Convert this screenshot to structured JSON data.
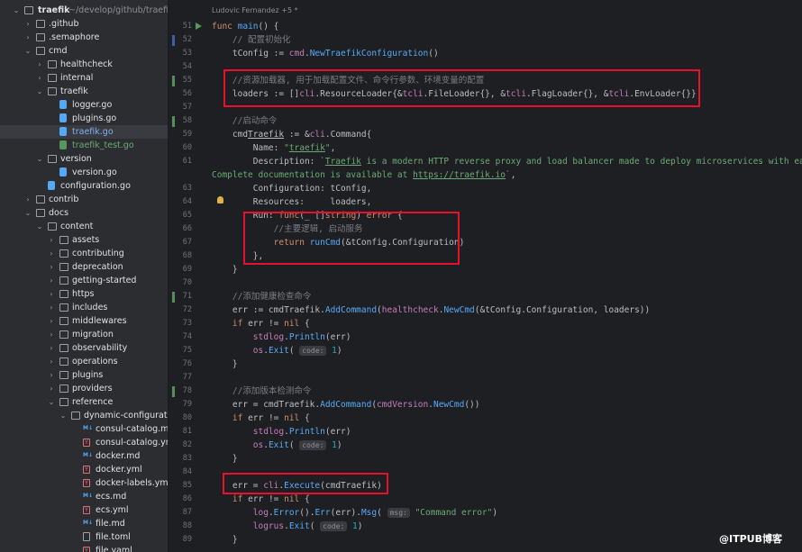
{
  "sidebar": {
    "root": {
      "name": "traefik",
      "path": "~/develop/github/traefik"
    },
    "items": [
      {
        "label": ".github",
        "type": "folder",
        "depth": 1,
        "open": false
      },
      {
        "label": ".semaphore",
        "type": "folder",
        "depth": 1,
        "open": false
      },
      {
        "label": "cmd",
        "type": "folder",
        "depth": 1,
        "open": true
      },
      {
        "label": "healthcheck",
        "type": "folder",
        "depth": 2,
        "open": false
      },
      {
        "label": "internal",
        "type": "folder",
        "depth": 2,
        "open": false
      },
      {
        "label": "traefik",
        "type": "folder",
        "depth": 2,
        "open": true
      },
      {
        "label": "logger.go",
        "type": "go",
        "depth": 3
      },
      {
        "label": "plugins.go",
        "type": "go",
        "depth": 3
      },
      {
        "label": "traefik.go",
        "type": "go",
        "depth": 3,
        "selected": true
      },
      {
        "label": "traefik_test.go",
        "type": "gotest",
        "depth": 3
      },
      {
        "label": "version",
        "type": "folder",
        "depth": 2,
        "open": true
      },
      {
        "label": "version.go",
        "type": "go",
        "depth": 3
      },
      {
        "label": "configuration.go",
        "type": "go",
        "depth": 2
      },
      {
        "label": "contrib",
        "type": "folder",
        "depth": 1,
        "open": false
      },
      {
        "label": "docs",
        "type": "folder",
        "depth": 1,
        "open": true
      },
      {
        "label": "content",
        "type": "folder",
        "depth": 2,
        "open": true
      },
      {
        "label": "assets",
        "type": "folder",
        "depth": 3,
        "open": false
      },
      {
        "label": "contributing",
        "type": "folder",
        "depth": 3,
        "open": false
      },
      {
        "label": "deprecation",
        "type": "folder",
        "depth": 3,
        "open": false
      },
      {
        "label": "getting-started",
        "type": "folder",
        "depth": 3,
        "open": false
      },
      {
        "label": "https",
        "type": "folder",
        "depth": 3,
        "open": false
      },
      {
        "label": "includes",
        "type": "folder",
        "depth": 3,
        "open": false
      },
      {
        "label": "middlewares",
        "type": "folder",
        "depth": 3,
        "open": false
      },
      {
        "label": "migration",
        "type": "folder",
        "depth": 3,
        "open": false
      },
      {
        "label": "observability",
        "type": "folder",
        "depth": 3,
        "open": false
      },
      {
        "label": "operations",
        "type": "folder",
        "depth": 3,
        "open": false
      },
      {
        "label": "plugins",
        "type": "folder",
        "depth": 3,
        "open": false
      },
      {
        "label": "providers",
        "type": "folder",
        "depth": 3,
        "open": false
      },
      {
        "label": "reference",
        "type": "folder",
        "depth": 3,
        "open": true
      },
      {
        "label": "dynamic-configuration",
        "type": "folder",
        "depth": 4,
        "open": true
      },
      {
        "label": "consul-catalog.md",
        "type": "md",
        "depth": 5
      },
      {
        "label": "consul-catalog.yml",
        "type": "yml",
        "depth": 5
      },
      {
        "label": "docker.md",
        "type": "md",
        "depth": 5
      },
      {
        "label": "docker.yml",
        "type": "yml",
        "depth": 5
      },
      {
        "label": "docker-labels.yml",
        "type": "yml",
        "depth": 5
      },
      {
        "label": "ecs.md",
        "type": "md",
        "depth": 5
      },
      {
        "label": "ecs.yml",
        "type": "yml",
        "depth": 5
      },
      {
        "label": "file.md",
        "type": "md",
        "depth": 5
      },
      {
        "label": "file.toml",
        "type": "toml",
        "depth": 5
      },
      {
        "label": "file.yaml",
        "type": "yml",
        "depth": 5
      }
    ]
  },
  "editor": {
    "author": "Ludovic Fernandez +5 *",
    "lines": [
      {
        "n": "51",
        "html": "<span class='kw'>func</span> <span class='fn'>main</span>() {",
        "mark": ""
      },
      {
        "n": "52",
        "html": "    <span class='cm'>// 配置初始化</span>",
        "mark": "mod"
      },
      {
        "n": "53",
        "html": "    tConfig := <span class='pk'>cmd</span>.<span class='fc'>NewTraefikConfiguration</span>()",
        "mark": ""
      },
      {
        "n": "54",
        "html": "",
        "mark": ""
      },
      {
        "n": "55",
        "html": "    <span class='cm'>//资源加载器, 用于加载配置文件、命令行参数、环境变量的配置</span>",
        "mark": "add"
      },
      {
        "n": "56",
        "html": "    loaders := []<span class='pk'>cli</span>.ResourceLoader{&amp;<span class='pk'>tcli</span>.FileLoader{}, &amp;<span class='pk'>tcli</span>.FlagLoader{}, &amp;<span class='pk'>tcli</span>.EnvLoader{}}",
        "mark": ""
      },
      {
        "n": "57",
        "html": "",
        "mark": ""
      },
      {
        "n": "58",
        "html": "    <span class='cm'>//启动命令</span>",
        "mark": "add"
      },
      {
        "n": "59",
        "html": "    cmd<span class='ul'>Traefik</span> := &amp;<span class='pk'>cli</span>.Command{",
        "mark": ""
      },
      {
        "n": "60",
        "html": "        Name: <span class='st'>\"<span class='ul'>traefik</span>\"</span>,",
        "mark": ""
      },
      {
        "n": "61",
        "html": "        Description: <span class='st'>`<span class='ul'>Traefik</span> is a modern HTTP reverse proxy and load balancer made to deploy microservices with ease.</span>",
        "mark": ""
      },
      {
        "n": "",
        "html": "<span class='st'>Complete documentation is available at <span class='ul'>https://traefik.io</span>`</span>,",
        "mark": "",
        "wrap": true
      },
      {
        "n": "63",
        "html": "        Configuration: tConfig,",
        "mark": ""
      },
      {
        "n": "64",
        "html": "        Resources:     loaders,",
        "mark": ""
      },
      {
        "n": "65",
        "html": "        Run: <span class='kw'>func</span>(_ []<span class='kw'>string</span>) <span class='kw'>error</span> {",
        "mark": ""
      },
      {
        "n": "66",
        "html": "            <span class='cm'>//主要逻辑, 启动服务</span>",
        "mark": ""
      },
      {
        "n": "67",
        "html": "            <span class='kw'>return</span> <span class='fc'>runCmd</span>(&amp;tConfig.Configuration)",
        "mark": ""
      },
      {
        "n": "68",
        "html": "        },",
        "mark": ""
      },
      {
        "n": "69",
        "html": "    }",
        "mark": ""
      },
      {
        "n": "70",
        "html": "",
        "mark": ""
      },
      {
        "n": "71",
        "html": "    <span class='cm'>//添加健康检查命令</span>",
        "mark": "add"
      },
      {
        "n": "72",
        "html": "    err := cmdTraefik.<span class='fc'>AddCommand</span>(<span class='pk'>healthcheck</span>.<span class='fc'>NewCmd</span>(&amp;tConfig.Configuration, loaders))",
        "mark": ""
      },
      {
        "n": "73",
        "html": "    <span class='kw'>if</span> err != <span class='kw'>nil</span> {",
        "mark": ""
      },
      {
        "n": "74",
        "html": "        <span class='pk'>stdlog</span>.<span class='fc'>Println</span>(err)",
        "mark": ""
      },
      {
        "n": "75",
        "html": "        <span class='pk'>os</span>.<span class='fc'>Exit</span>( <span class='hint'>code:</span> <span class='nb'>1</span>)",
        "mark": ""
      },
      {
        "n": "76",
        "html": "    }",
        "mark": ""
      },
      {
        "n": "77",
        "html": "",
        "mark": ""
      },
      {
        "n": "78",
        "html": "    <span class='cm'>//添加版本检测命令</span>",
        "mark": "add"
      },
      {
        "n": "79",
        "html": "    err = cmdTraefik.<span class='fc'>AddCommand</span>(<span class='pk'>cmdVersion</span>.<span class='fc'>NewCmd</span>())",
        "mark": ""
      },
      {
        "n": "80",
        "html": "    <span class='kw'>if</span> err != <span class='kw'>nil</span> {",
        "mark": ""
      },
      {
        "n": "81",
        "html": "        <span class='pk'>stdlog</span>.<span class='fc'>Println</span>(err)",
        "mark": ""
      },
      {
        "n": "82",
        "html": "        <span class='pk'>os</span>.<span class='fc'>Exit</span>( <span class='hint'>code:</span> <span class='nb'>1</span>)",
        "mark": ""
      },
      {
        "n": "83",
        "html": "    }",
        "mark": ""
      },
      {
        "n": "84",
        "html": "",
        "mark": ""
      },
      {
        "n": "85",
        "html": "    err = <span class='pk'>cli</span>.<span class='fc'>Execute</span>(cmdTraefik)",
        "mark": ""
      },
      {
        "n": "86",
        "html": "    <span class='kw'>if</span> err != <span class='kw'>nil</span> {",
        "mark": ""
      },
      {
        "n": "87",
        "html": "        <span class='pk'>log</span>.<span class='fc'>Error</span>().<span class='fc'>Err</span>(err).<span class='fc'>Msg</span>( <span class='hint'>msg:</span> <span class='st'>\"Command error\"</span>)",
        "mark": ""
      },
      {
        "n": "88",
        "html": "        <span class='pk'>logrus</span>.<span class='fc'>Exit</span>( <span class='hint'>code:</span> <span class='nb'>1</span>)",
        "mark": ""
      },
      {
        "n": "89",
        "html": "    }",
        "mark": ""
      }
    ]
  },
  "watermark": "@ITPUB博客"
}
